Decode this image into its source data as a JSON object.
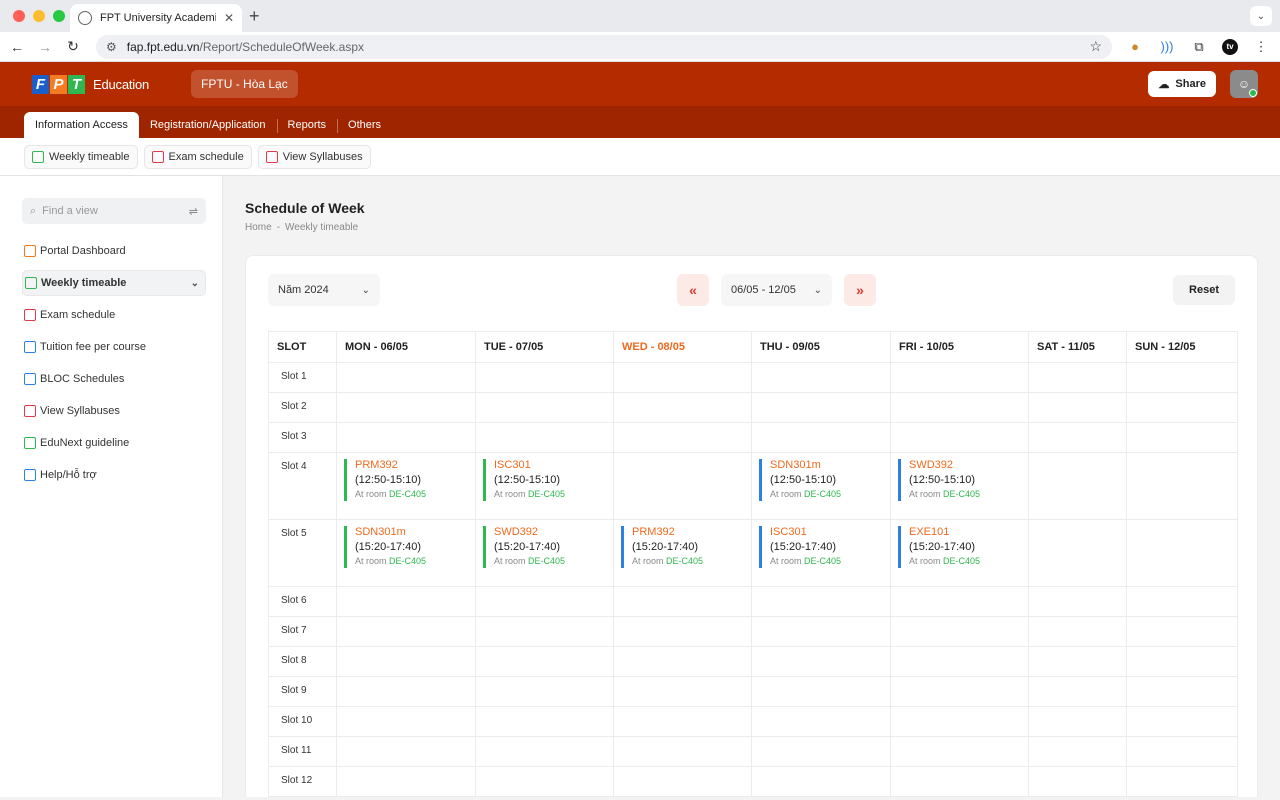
{
  "browser": {
    "tab_title": "FPT University Academic Portal",
    "url_host": "fap.fpt.edu.vn",
    "url_path": "/Report/ScheduleOfWeek.aspx"
  },
  "header": {
    "logo_letters": [
      "F",
      "P",
      "T"
    ],
    "logo_colors": [
      "#1a5fc9",
      "#f57a20",
      "#2fb84f"
    ],
    "logo_text": "Education",
    "campus": "FPTU - Hòa Lạc",
    "share_label": "Share"
  },
  "menu": [
    "Information Access",
    "Registration/Application",
    "Reports",
    "Others"
  ],
  "subnav": [
    "Weekly timeable",
    "Exam schedule",
    "View Syllabuses"
  ],
  "sidebar": {
    "search_placeholder": "Find a view",
    "items": [
      {
        "label": "Portal Dashboard",
        "icon": "orange"
      },
      {
        "label": "Weekly timeable",
        "icon": "green"
      },
      {
        "label": "Exam schedule",
        "icon": "red"
      },
      {
        "label": "Tuition fee per course",
        "icon": "blue"
      },
      {
        "label": "BLOC Schedules",
        "icon": "blue"
      },
      {
        "label": "View Syllabuses",
        "icon": "red"
      },
      {
        "label": "EduNext guideline",
        "icon": "green"
      },
      {
        "label": "Help/Hỗ trợ",
        "icon": "blue"
      }
    ]
  },
  "main": {
    "title": "Schedule of Week",
    "breadcrumb": [
      "Home",
      "-",
      "Weekly timeable"
    ],
    "year": "Năm 2024",
    "prev": "«",
    "week": "06/05 - 12/05",
    "next": "»",
    "reset": "Reset"
  },
  "schedule": {
    "columns": [
      "SLOT",
      "MON - 06/05",
      "TUE - 07/05",
      "WED - 08/05",
      "THU - 09/05",
      "FRI - 10/05",
      "SAT - 11/05",
      "SUN - 12/05"
    ],
    "room_prefix": "At room",
    "slots": [
      "Slot 1",
      "Slot 2",
      "Slot 3",
      "Slot 4",
      "Slot 5",
      "Slot 6",
      "Slot 7",
      "Slot 8",
      "Slot 9",
      "Slot 10",
      "Slot 11",
      "Slot 12"
    ],
    "slot4": [
      {
        "code": "PRM392",
        "time": "(12:50-15:10)",
        "room": "DE-C405",
        "bar": "green"
      },
      {
        "code": "ISC301",
        "time": "(12:50-15:10)",
        "room": "DE-C405",
        "bar": "green"
      },
      null,
      {
        "code": "SDN301m",
        "time": "(12:50-15:10)",
        "room": "DE-C405",
        "bar": "blue"
      },
      {
        "code": "SWD392",
        "time": "(12:50-15:10)",
        "room": "DE-C405",
        "bar": "blue"
      },
      null,
      null
    ],
    "slot5": [
      {
        "code": "SDN301m",
        "time": "(15:20-17:40)",
        "room": "DE-C405",
        "bar": "green"
      },
      {
        "code": "SWD392",
        "time": "(15:20-17:40)",
        "room": "DE-C405",
        "bar": "green"
      },
      {
        "code": "PRM392",
        "time": "(15:20-17:40)",
        "room": "DE-C405",
        "bar": "blue"
      },
      {
        "code": "ISC301",
        "time": "(15:20-17:40)",
        "room": "DE-C405",
        "bar": "blue"
      },
      {
        "code": "EXE101",
        "time": "(15:20-17:40)",
        "room": "DE-C405",
        "bar": "blue"
      },
      null,
      null
    ]
  }
}
